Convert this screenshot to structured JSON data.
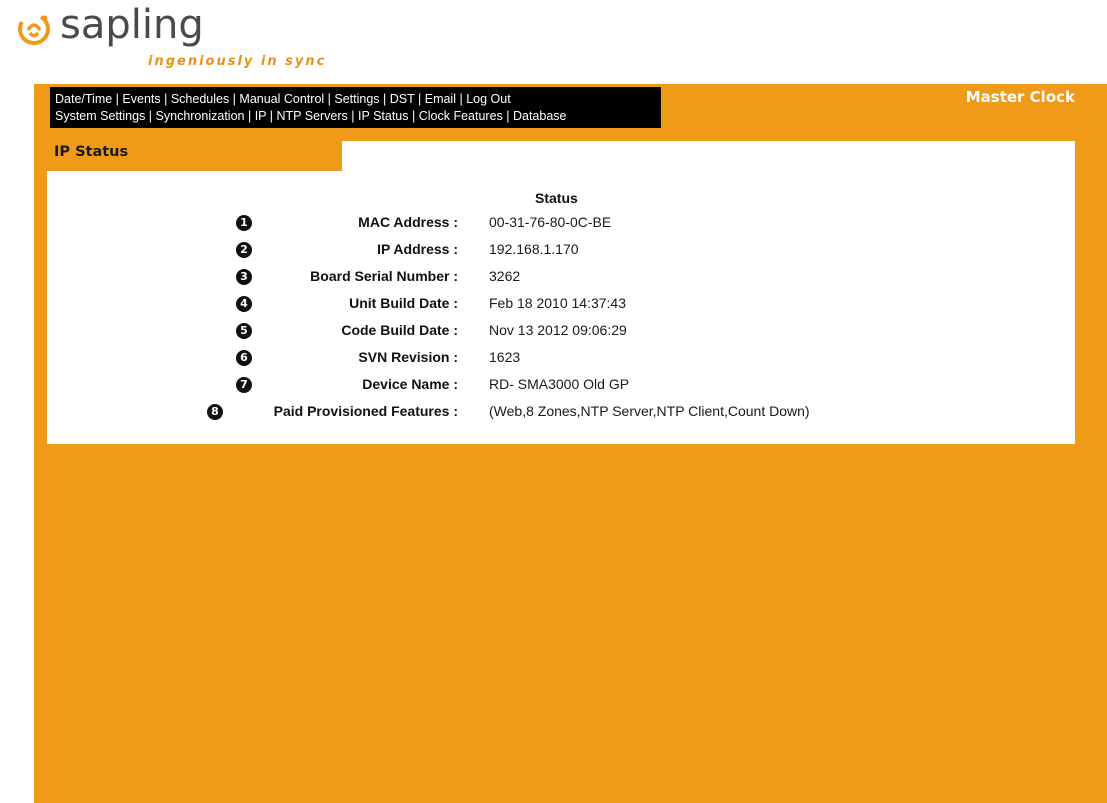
{
  "brand": {
    "name": "sapling",
    "tagline": "ingeniously in sync",
    "accent": "#f09a1a",
    "logo_icon": "sapling-logo-icon"
  },
  "nav": {
    "row1": [
      "Date/Time",
      "Events",
      "Schedules",
      "Manual Control",
      "Settings",
      "DST",
      "Email",
      "Log Out"
    ],
    "row2": [
      "System Settings",
      "Synchronization",
      "IP",
      "NTP Servers",
      "IP Status",
      "Clock Features",
      "Database"
    ],
    "separator": "|"
  },
  "device_label": "Master Clock",
  "page_title": "IP Status",
  "status": {
    "heading": "Status",
    "rows": [
      {
        "num": "1",
        "label": "MAC Address :",
        "value": "00-31-76-80-0C-BE"
      },
      {
        "num": "2",
        "label": "IP Address :",
        "value": "192.168.1.170"
      },
      {
        "num": "3",
        "label": "Board Serial Number :",
        "value": "3262"
      },
      {
        "num": "4",
        "label": "Unit Build Date :",
        "value": "Feb 18 2010 14:37:43"
      },
      {
        "num": "5",
        "label": "Code Build Date :",
        "value": "Nov 13 2012 09:06:29"
      },
      {
        "num": "6",
        "label": "SVN Revision :",
        "value": "1623"
      },
      {
        "num": "7",
        "label": "Device Name :",
        "value": "RD- SMA3000 Old GP"
      },
      {
        "num": "8",
        "label": "Paid Provisioned Features :",
        "value": "(Web,8 Zones,NTP Server,NTP Client,Count Down)"
      }
    ]
  }
}
